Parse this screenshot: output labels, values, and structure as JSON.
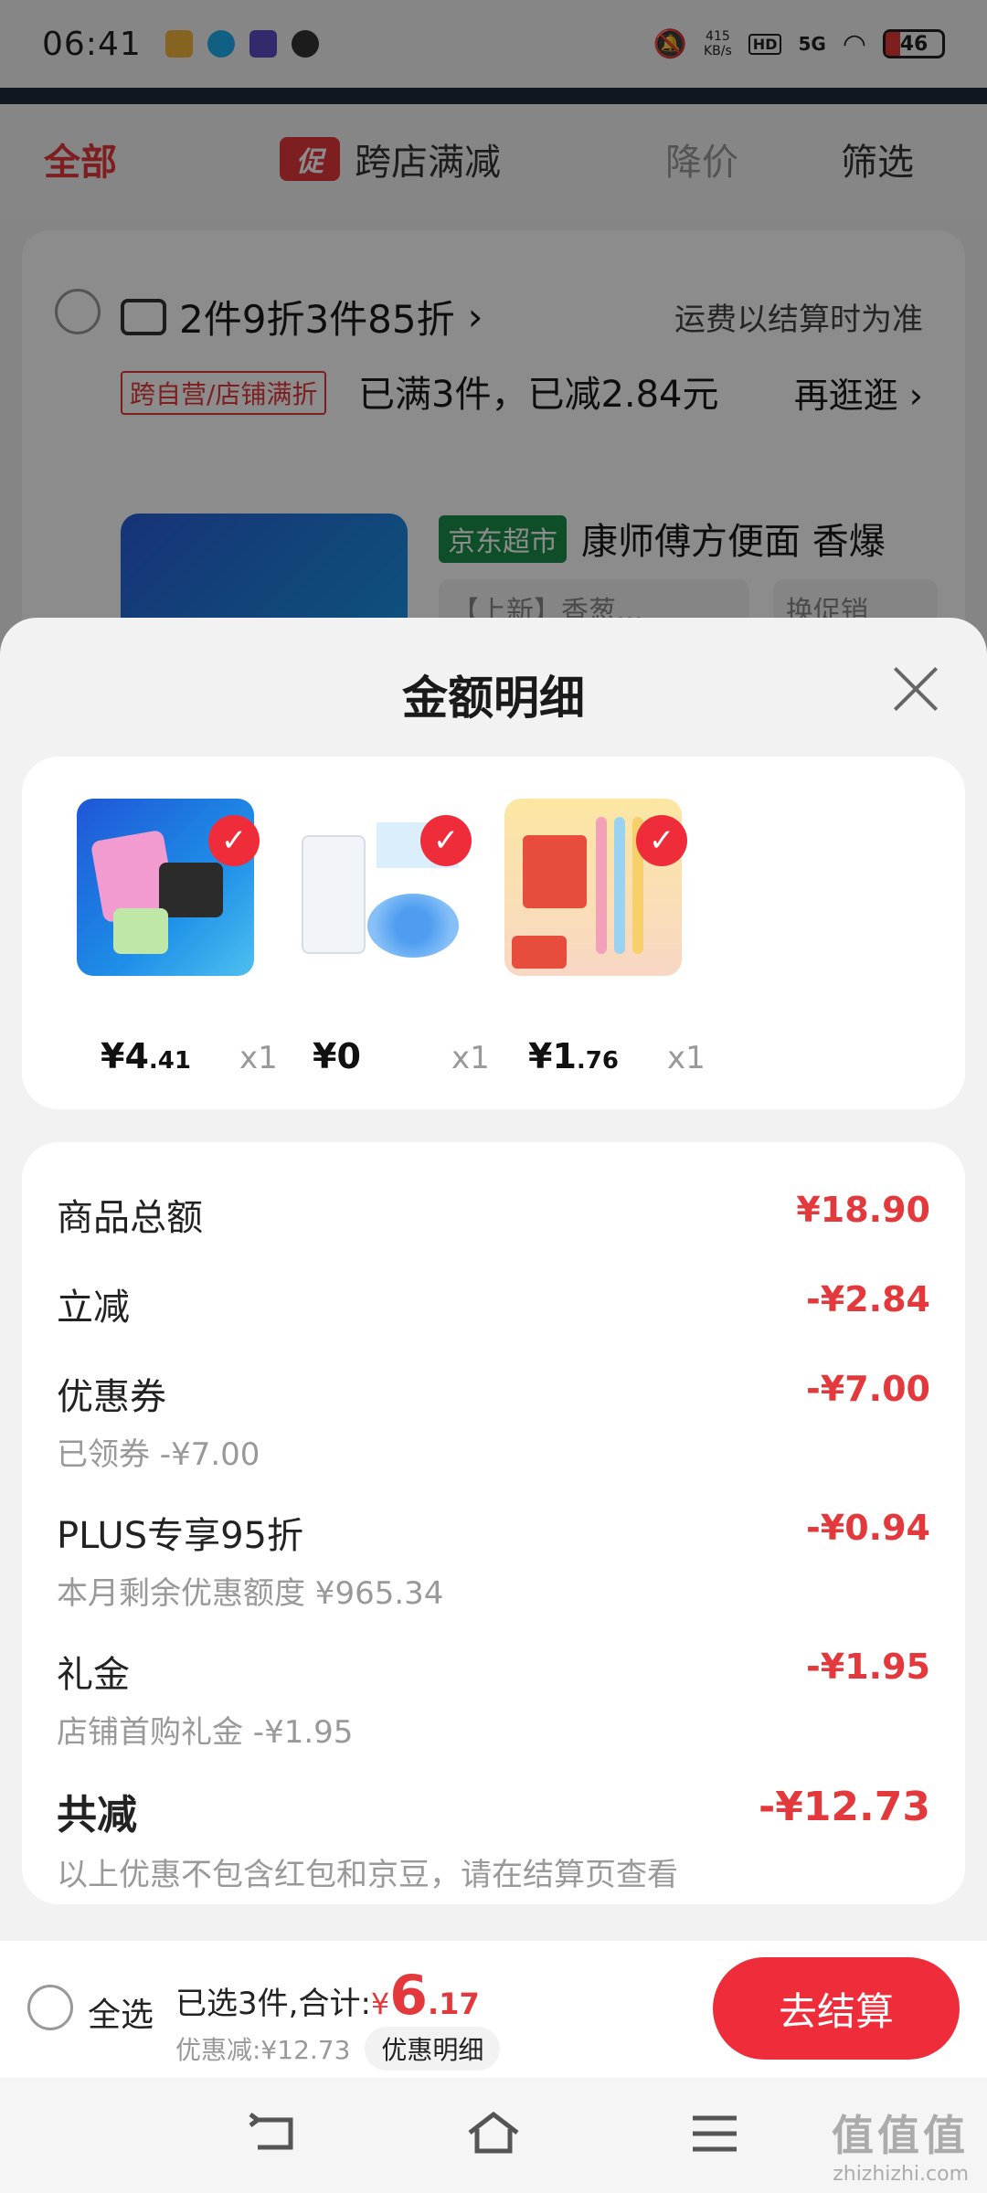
{
  "status_bar": {
    "time": "06:41",
    "speed": "415",
    "speed_unit": "KB/s",
    "hd": "HD",
    "network": "5G",
    "battery": "46"
  },
  "tabs": {
    "all": "全部",
    "promo_badge": "促",
    "cross_store": "跨店满减",
    "price_drop": "降价",
    "filter": "筛选"
  },
  "store_card": {
    "promo": "2件9折3件85折",
    "shipping": "运费以结算时为准",
    "tag": "跨自营/店铺满折",
    "full_text": "已满3件，已减2.84元",
    "more": "再逛逛",
    "jd_tag": "京东超市",
    "title": "康师傅方便面 香爆",
    "spec": "【上新】香葱…",
    "promo_switch": "换促销"
  },
  "sheet": {
    "title": "金额明细"
  },
  "goods": [
    {
      "price_int": "¥4",
      "price_dec": ".41",
      "qty": "x1"
    },
    {
      "price_int": "¥0",
      "price_dec": "",
      "qty": "x1"
    },
    {
      "price_int": "¥1",
      "price_dec": ".76",
      "qty": "x1"
    }
  ],
  "details": {
    "subtotal": {
      "label": "商品总额",
      "value": "¥18.90"
    },
    "instant": {
      "label": "立减",
      "value": "-¥2.84"
    },
    "coupon": {
      "label": "优惠券",
      "value": "-¥7.00",
      "sub": "已领券 -¥7.00"
    },
    "plus": {
      "label": "PLUS专享95折",
      "value": "-¥0.94",
      "sub": "本月剩余优惠额度 ¥965.34"
    },
    "gift": {
      "label": "礼金",
      "value": "-¥1.95",
      "sub": "店铺首购礼金 -¥1.95"
    },
    "total": {
      "label": "共减",
      "value": "-¥12.73",
      "sub": "以上优惠不包含红包和京豆，请在结算页查看"
    }
  },
  "bottom": {
    "select_all": "全选",
    "selected_text": "已选3件,合计:",
    "yen": "¥",
    "total_int": "6",
    "total_dec": ".17",
    "discount_text": "优惠减:¥12.73",
    "detail_btn": "优惠明细",
    "checkout": "去结算"
  },
  "watermark": {
    "title": "值值值",
    "url": "zhizhizhi.com"
  }
}
